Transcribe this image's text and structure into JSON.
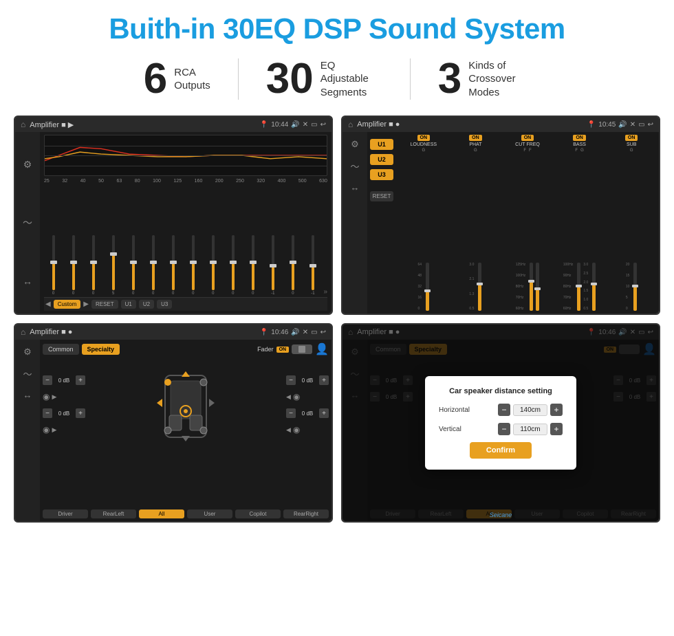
{
  "page": {
    "title": "Buith-in 30EQ DSP Sound System",
    "background": "#ffffff"
  },
  "stats": [
    {
      "number": "6",
      "label": "RCA\nOutputs"
    },
    {
      "number": "30",
      "label": "EQ Adjustable\nSegments"
    },
    {
      "number": "3",
      "label": "Kinds of\nCrossover Modes"
    }
  ],
  "screens": {
    "eq": {
      "app_name": "Amplifier",
      "time": "10:44",
      "freq_labels": [
        "25",
        "32",
        "40",
        "50",
        "63",
        "80",
        "100",
        "125",
        "160",
        "200",
        "250",
        "320",
        "400",
        "500",
        "630"
      ],
      "slider_values": [
        "0",
        "0",
        "0",
        "5",
        "0",
        "0",
        "0",
        "0",
        "0",
        "0",
        "0",
        "-1",
        "0",
        "-1"
      ],
      "bottom_buttons": [
        "Custom",
        "RESET",
        "U1",
        "U2",
        "U3"
      ]
    },
    "amp": {
      "app_name": "Amplifier",
      "time": "10:45",
      "presets": [
        "U1",
        "U2",
        "U3"
      ],
      "bands": [
        {
          "name": "LOUDNESS",
          "toggle": "ON"
        },
        {
          "name": "PHAT",
          "toggle": "ON"
        },
        {
          "name": "CUT FREQ",
          "toggle": "ON"
        },
        {
          "name": "BASS",
          "toggle": "ON"
        },
        {
          "name": "SUB",
          "toggle": "ON"
        }
      ]
    },
    "speaker": {
      "app_name": "Amplifier",
      "time": "10:46",
      "tabs": [
        "Common",
        "Specialty"
      ],
      "fader_label": "Fader",
      "fader_state": "ON",
      "volumes": [
        "0 dB",
        "0 dB",
        "0 dB",
        "0 dB"
      ],
      "channel_buttons": [
        "Driver",
        "Copilot",
        "RearLeft",
        "All",
        "User",
        "RearRight"
      ]
    },
    "dialog": {
      "app_name": "Amplifier",
      "time": "10:46",
      "title": "Car speaker distance setting",
      "horizontal_label": "Horizontal",
      "horizontal_value": "140cm",
      "vertical_label": "Vertical",
      "vertical_value": "110cm",
      "confirm_label": "Confirm",
      "tabs": [
        "Common",
        "Specialty"
      ],
      "channel_buttons": [
        "Driver",
        "Copilot",
        "RearLeft",
        "All",
        "User",
        "RearRight"
      ]
    }
  },
  "watermark": "Seicane"
}
